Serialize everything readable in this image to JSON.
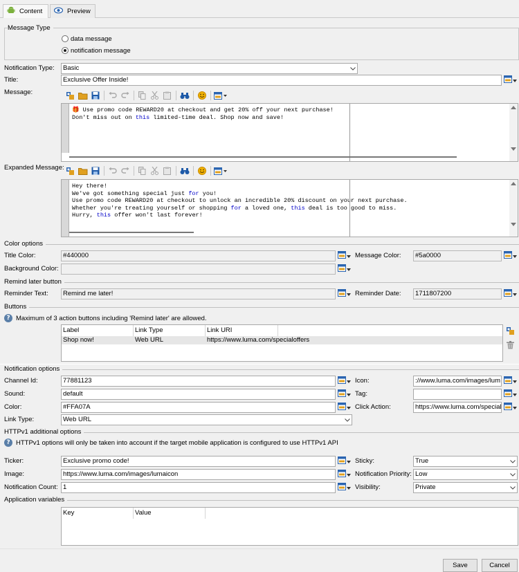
{
  "tabs": [
    {
      "label": "Content",
      "icon": "android-icon"
    },
    {
      "label": "Preview",
      "icon": "eye-icon"
    }
  ],
  "message_type": {
    "title": "Message Type",
    "options": [
      "data message",
      "notification message"
    ],
    "selected": "notification message"
  },
  "notification_type": {
    "label": "Notification Type:",
    "value": "Basic"
  },
  "title_field": {
    "label": "Title:",
    "value": "Exclusive Offer Inside!"
  },
  "message": {
    "label": "Message:",
    "lines": [
      [
        {
          "t": "🎁 Use promo code REWARD20 at checkout and get 20% off your next purchase!"
        }
      ],
      [
        {
          "t": "Don't miss out on "
        },
        {
          "t": "this",
          "kw": true
        },
        {
          "t": " limited-time deal. Shop now and save!"
        }
      ]
    ]
  },
  "expanded_message": {
    "label": "Expanded Message:",
    "lines": [
      [
        {
          "t": "Hey there!"
        }
      ],
      [
        {
          "t": "We've got something special just "
        },
        {
          "t": "for",
          "kw": true
        },
        {
          "t": " you!"
        }
      ],
      [
        {
          "t": "Use promo code REWARD20 at checkout to unlock an incredible 20% discount on your next purchase."
        }
      ],
      [
        {
          "t": "Whether you're treating yourself or shopping "
        },
        {
          "t": "for",
          "kw": true
        },
        {
          "t": " a loved one, "
        },
        {
          "t": "this",
          "kw": true
        },
        {
          "t": " deal is too good to miss."
        }
      ],
      [
        {
          "t": "Hurry, "
        },
        {
          "t": "this",
          "kw": true
        },
        {
          "t": " offer won't last forever!"
        }
      ]
    ]
  },
  "color_options": {
    "title": "Color options",
    "title_color": {
      "label": "Title Color:",
      "value": "#440000"
    },
    "message_color": {
      "label": "Message Color:",
      "value": "#5a0000"
    },
    "background_color": {
      "label": "Background Color:",
      "value": ""
    }
  },
  "remind_later": {
    "title": "Remind later button",
    "reminder_text": {
      "label": "Reminder Text:",
      "value": "Remind me later!"
    },
    "reminder_date": {
      "label": "Reminder Date:",
      "value": "1711807200"
    }
  },
  "buttons": {
    "title": "Buttons",
    "info": "Maximum of 3 action buttons including 'Remind later' are allowed.",
    "columns": [
      "Label",
      "Link Type",
      "Link URI"
    ],
    "rows": [
      [
        "Shop now!",
        "Web URL",
        "https://www.luma.com/specialoffers"
      ]
    ]
  },
  "notification_options": {
    "title": "Notification options",
    "channel_id": {
      "label": "Channel Id:",
      "value": "77881123"
    },
    "icon": {
      "label": "Icon:",
      "value": "://www.luma.com/images/lum"
    },
    "sound": {
      "label": "Sound:",
      "value": "default"
    },
    "tag": {
      "label": "Tag:",
      "value": ""
    },
    "color": {
      "label": "Color:",
      "value": "#FFA07A"
    },
    "click_action": {
      "label": "Click Action:",
      "value": "https://www.luma.com/special"
    },
    "link_type": {
      "label": "Link Type:",
      "value": "Web URL"
    }
  },
  "httpv1": {
    "title": "HTTPv1 additional options",
    "info": "HTTPv1 options will only be taken into account if the target mobile application is configured to use HTTPv1 API",
    "ticker": {
      "label": "Ticker:",
      "value": "Exclusive promo code!"
    },
    "sticky": {
      "label": "Sticky:",
      "value": "True"
    },
    "image": {
      "label": "Image:",
      "value": "https://www.luma.com/images/lumaicon"
    },
    "priority": {
      "label": "Notification Priority:",
      "value": "Low"
    },
    "count": {
      "label": "Notification Count:",
      "value": "1"
    },
    "visibility": {
      "label": "Visibility:",
      "value": "Private"
    }
  },
  "app_vars": {
    "title": "Application variables",
    "columns": [
      "Key",
      "Value"
    ]
  },
  "footer": {
    "save": "Save",
    "cancel": "Cancel"
  },
  "colors": {
    "accent": "#1e5aa8",
    "folder": "#e0a020",
    "keyword": "#0000c8"
  }
}
